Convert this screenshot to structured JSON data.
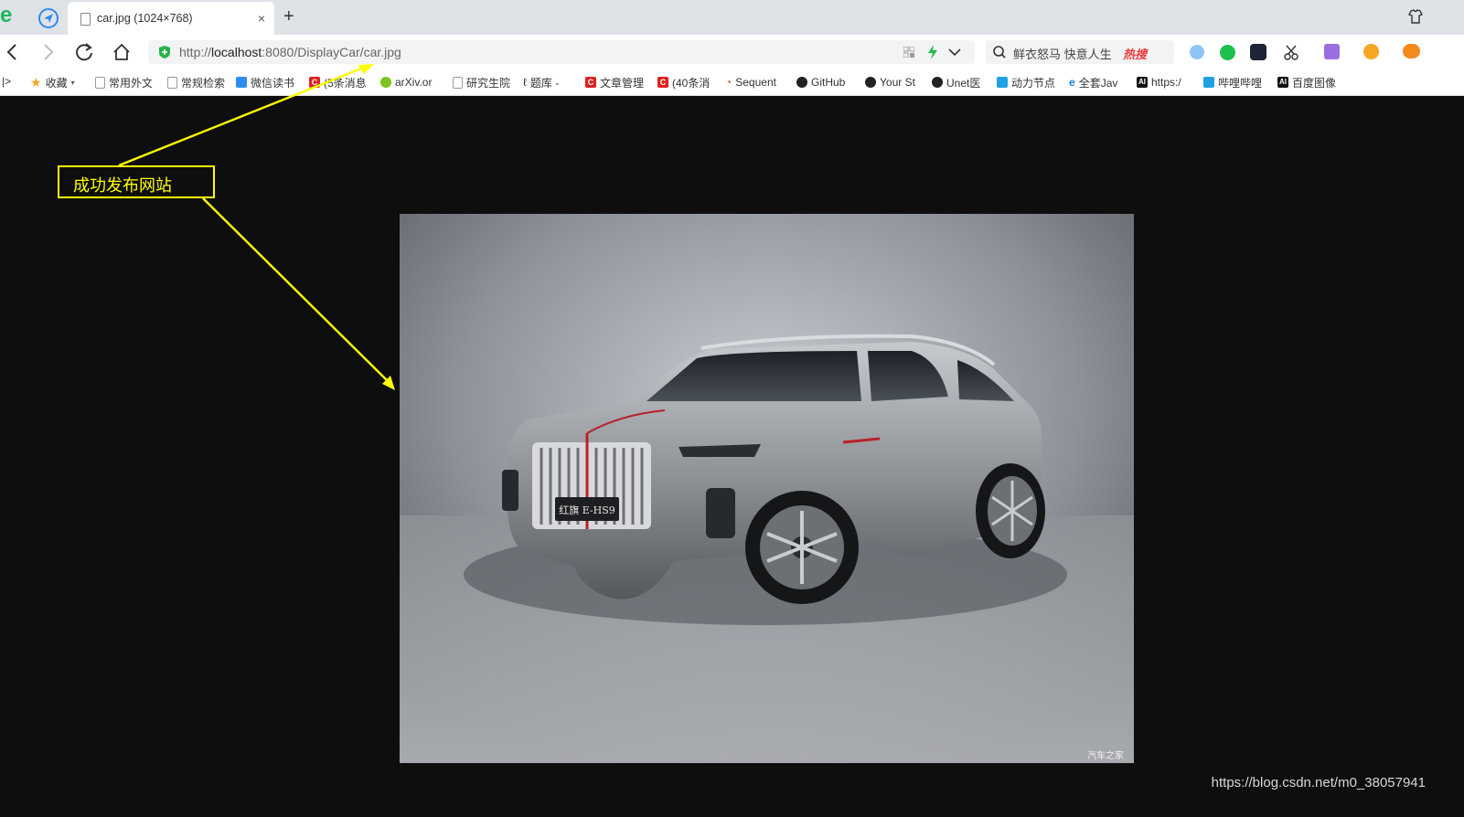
{
  "tab": {
    "title": "car.jpg (1024×768)",
    "close": "×",
    "new_tab": "+"
  },
  "nav": {
    "url_prefix": "http://",
    "url_host": "localhost",
    "url_rest": ":8080/DisplayCar/car.jpg",
    "search_text": "鲜衣怒马 快意人生",
    "hot_badge": "热搜"
  },
  "bookmarks": [
    {
      "label": "收藏",
      "icon": "star-icon",
      "color": "#f5a623"
    },
    {
      "label": "常用外文",
      "icon": "page-icon",
      "color": "#999999"
    },
    {
      "label": "常规检索",
      "icon": "page-icon",
      "color": "#999999"
    },
    {
      "label": "微信读书",
      "icon": "weread-icon",
      "color": "#2f8cf0"
    },
    {
      "label": "(5条消息",
      "icon": "csdn-icon",
      "color": "#e02020"
    },
    {
      "label": "arXiv.or",
      "icon": "smiley-icon",
      "color": "#7cc520"
    },
    {
      "label": "研究生院",
      "icon": "page-icon",
      "color": "#999999"
    },
    {
      "label": "题库 -",
      "icon": "leetcode-icon",
      "color": "#333333"
    },
    {
      "label": "文章管理",
      "icon": "csdn-icon",
      "color": "#e02020"
    },
    {
      "label": "(40条消",
      "icon": "csdn-icon",
      "color": "#e02020"
    },
    {
      "label": "Sequent",
      "icon": "swirl-icon",
      "color": "#e8442c"
    },
    {
      "label": "GitHub",
      "icon": "github-icon",
      "color": "#222222"
    },
    {
      "label": "Your St",
      "icon": "github-icon",
      "color": "#222222"
    },
    {
      "label": "Unet医",
      "icon": "github-icon",
      "color": "#222222"
    },
    {
      "label": "动力节点",
      "icon": "bilibili-icon",
      "color": "#20a0e0"
    },
    {
      "label": "全套Jav",
      "icon": "ie-icon",
      "color": "#1d7fd6"
    },
    {
      "label": "https:/",
      "icon": "ai-icon",
      "color": "#111111"
    },
    {
      "label": "哔哩哔哩",
      "icon": "bilibili-icon",
      "color": "#20a0e0"
    },
    {
      "label": "百度图像",
      "icon": "ai-icon",
      "color": "#111111"
    }
  ],
  "annotation": {
    "text": "成功发布网站"
  },
  "photo": {
    "credit": "汽车之家",
    "plate": "红旗 E-HS9"
  },
  "watermark": "https://blog.csdn.net/m0_38057941",
  "colors": {
    "annotation": "#ffff00",
    "background": "#0e0e0e"
  }
}
